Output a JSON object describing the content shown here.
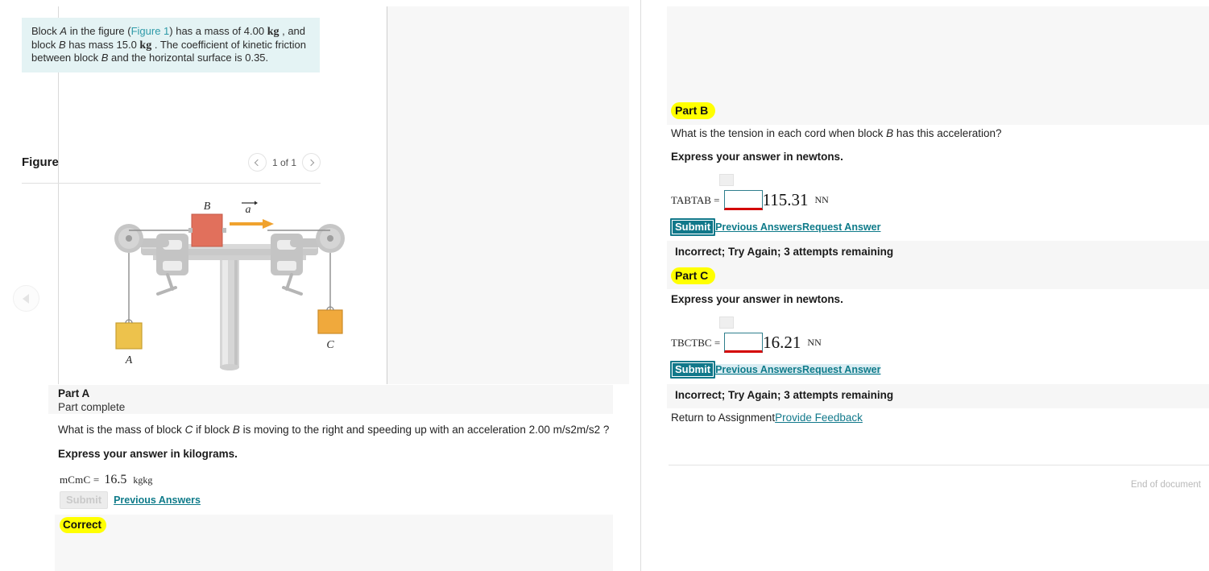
{
  "collapse": {
    "icon": "left-triangle-icon"
  },
  "problem": {
    "text_1": "Block ",
    "italic_A": "A",
    "text_2": " in the figure (",
    "figure_link": "Figure 1",
    "text_3": ") has a mass of 4.00 ",
    "unit_kg_1": "kg",
    "text_4": " , and block ",
    "italic_B": "B",
    "text_5": " has mass 15.0 ",
    "unit_kg_2": "kg",
    "text_6": " . The coefficient of kinetic friction between block ",
    "italic_B2": "B",
    "text_7": " and the horizontal surface is 0.35."
  },
  "figure": {
    "title": "Figure",
    "counter": "1 of 1",
    "prev_icon": "chevron-left-icon",
    "next_icon": "chevron-right-icon",
    "labels": {
      "block_b": "B",
      "accel": "a",
      "block_a": "A",
      "block_c": "C"
    }
  },
  "part_a": {
    "label": "Part A",
    "state": "Part complete",
    "question_pre": "What is the mass of block ",
    "question_C": "C",
    "question_mid": " if block ",
    "question_B": "B",
    "question_post": " is moving to the right and speeding up with an acceleration 2.00 m/s2m/s2 ?",
    "express": "Express your answer in kilograms.",
    "answer_label": "mCmC =",
    "answer_value": "16.5",
    "answer_unit": "kgkg",
    "submit_label": "Submit",
    "previous_answers_label": "Previous Answers",
    "status": "Correct"
  },
  "part_b": {
    "label": "Part B",
    "question_pre": "What is the tension in each cord when block ",
    "question_B": "B",
    "question_post": " has this acceleration?",
    "express": "Express your answer in newtons.",
    "answer_label": "TABTAB =",
    "answer_input_value": "",
    "answer_value": "115.31",
    "answer_unit": "NN",
    "submit_label": "Submit",
    "previous_answers_label": "Previous Answers",
    "request_answer_label": "Request Answer",
    "status": "Incorrect; Try Again; 3 attempts remaining"
  },
  "part_c": {
    "label": "Part C",
    "express": "Express your answer in newtons.",
    "answer_label": "TBCTBC =",
    "answer_input_value": "",
    "answer_value": "16.21",
    "answer_unit": "NN",
    "submit_label": "Submit",
    "previous_answers_label": "Previous Answers",
    "request_answer_label": "Request Answer",
    "status": "Incorrect; Try Again; 3 attempts remaining"
  },
  "footer": {
    "return_label": "Return to Assignment",
    "feedback_label": "Provide Feedback",
    "end_of_document": "End of document"
  },
  "colors": {
    "problem_bg": "#e4f3f4",
    "highlight": "#ffff00",
    "link_teal": "#0f7b8a",
    "submit_bg": "#11788a",
    "error_underline": "#d40000",
    "panel_gray": "#f7f7f7"
  }
}
